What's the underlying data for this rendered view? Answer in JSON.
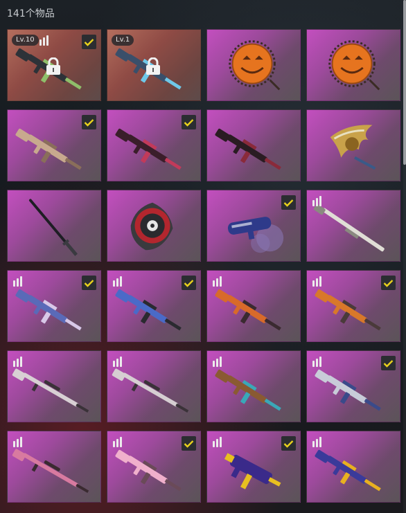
{
  "header": {
    "count_text": "141个物品"
  },
  "colors": {
    "check": "#e8d21c",
    "accent_purple": "#c34fbf"
  },
  "items": [
    {
      "name": "rifle-locked-1",
      "level": "Lv.10",
      "checked": true,
      "tier": true,
      "locked": true,
      "bg": "red",
      "icon": "rifle-icon"
    },
    {
      "name": "rifle-locked-2",
      "level": "Lv.1",
      "checked": false,
      "tier": false,
      "locked": true,
      "bg": "red",
      "icon": "rifle-icon"
    },
    {
      "name": "pumpkin-spray-1",
      "checked": false,
      "tier": false,
      "bg": "purple",
      "icon": "pumpkin-emblem-icon"
    },
    {
      "name": "pumpkin-spray-2",
      "checked": false,
      "tier": false,
      "bg": "purple",
      "icon": "pumpkin-emblem-icon"
    },
    {
      "name": "rifle-tan",
      "checked": true,
      "tier": false,
      "bg": "purple",
      "icon": "rifle-icon"
    },
    {
      "name": "rifle-red",
      "checked": true,
      "tier": false,
      "bg": "purple",
      "icon": "rifle-icon"
    },
    {
      "name": "rifle-dark",
      "checked": false,
      "tier": false,
      "bg": "purple",
      "icon": "rifle-icon"
    },
    {
      "name": "gold-wing-emblem",
      "checked": false,
      "tier": false,
      "bg": "purple",
      "icon": "wing-emblem-icon"
    },
    {
      "name": "katana",
      "checked": false,
      "tier": false,
      "bg": "purple",
      "icon": "katana-icon"
    },
    {
      "name": "shuriken-emblem",
      "checked": false,
      "tier": false,
      "bg": "purple",
      "icon": "shuriken-icon"
    },
    {
      "name": "launcher",
      "checked": true,
      "tier": false,
      "bg": "purple",
      "icon": "launcher-icon"
    },
    {
      "name": "shotgun-white",
      "checked": false,
      "tier": true,
      "bg": "purple",
      "icon": "shotgun-icon"
    },
    {
      "name": "rifle-blue-1",
      "checked": true,
      "tier": true,
      "bg": "purple",
      "icon": "rifle-icon"
    },
    {
      "name": "rifle-blue-2",
      "checked": true,
      "tier": true,
      "bg": "purple",
      "icon": "rifle-icon"
    },
    {
      "name": "rifle-orange-1",
      "checked": false,
      "tier": true,
      "bg": "purple",
      "icon": "rifle-icon"
    },
    {
      "name": "rifle-orange-2",
      "checked": true,
      "tier": true,
      "bg": "purple",
      "icon": "rifle-icon"
    },
    {
      "name": "sniper-white-1",
      "checked": false,
      "tier": true,
      "bg": "purple",
      "icon": "sniper-icon"
    },
    {
      "name": "sniper-white-2",
      "checked": false,
      "tier": true,
      "bg": "purple",
      "icon": "sniper-icon"
    },
    {
      "name": "rifle-leopard",
      "checked": false,
      "tier": true,
      "bg": "purple",
      "icon": "rifle-icon"
    },
    {
      "name": "rifle-silver",
      "checked": true,
      "tier": true,
      "bg": "purple",
      "icon": "rifle-icon"
    },
    {
      "name": "sniper-pink",
      "checked": false,
      "tier": true,
      "bg": "purple",
      "icon": "sniper-icon"
    },
    {
      "name": "rifle-pink",
      "checked": true,
      "tier": true,
      "bg": "purple",
      "icon": "rifle-icon"
    },
    {
      "name": "smg-purple",
      "checked": true,
      "tier": true,
      "bg": "purple",
      "icon": "smg-icon"
    },
    {
      "name": "rifle-purple",
      "checked": false,
      "tier": true,
      "bg": "purple",
      "icon": "rifle-icon"
    }
  ]
}
